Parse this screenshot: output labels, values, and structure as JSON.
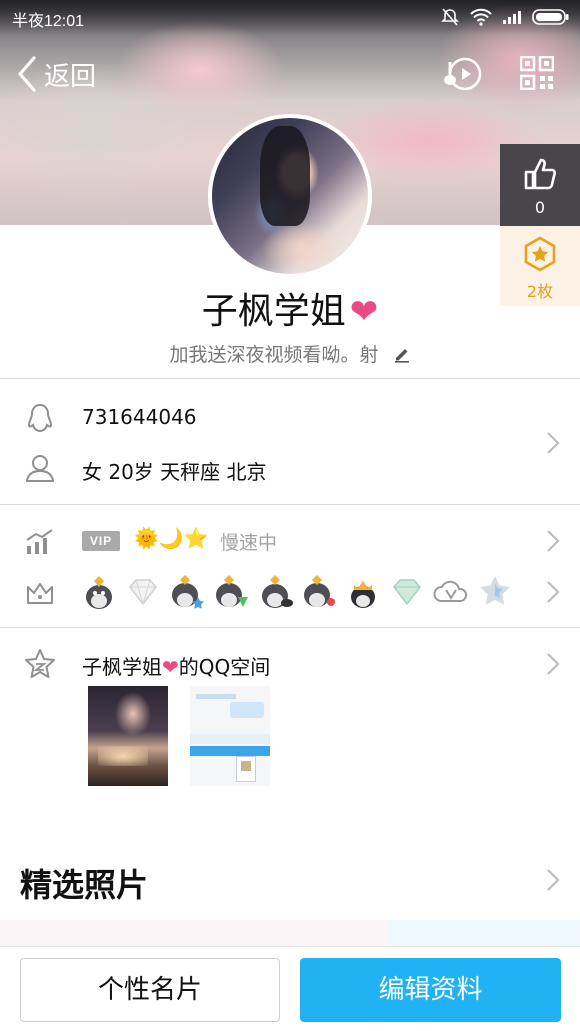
{
  "status_bar": {
    "time": "半夜12:01"
  },
  "nav": {
    "back_label": "返回"
  },
  "profile": {
    "name": "子枫学姐",
    "signature": "加我送深夜视频看呦。射",
    "likes": "0",
    "medals": "2枚"
  },
  "info": {
    "qq_number": "731644046",
    "details": "女  20岁  天秤座  北京"
  },
  "vip": {
    "tag": "VIP",
    "level_icons": "🌞🌙⭐",
    "speed_text": "慢速中"
  },
  "badges": [
    "penguin-gold-badge",
    "diamond-badge",
    "penguin-star-badge",
    "penguin-green-badge",
    "penguin-badge",
    "penguin-game-badge",
    "penguin-crown-badge",
    "gem-badge",
    "cloud-v-badge",
    "star-badge"
  ],
  "qzone": {
    "title_prefix": "子枫学姐",
    "title_suffix": "的QQ空间"
  },
  "featured": {
    "title": "精选照片"
  },
  "bottom": {
    "card_button": "个性名片",
    "edit_button": "编辑资料"
  },
  "colors": {
    "accent": "#21b2f3",
    "heart": "#e94a85",
    "medal": "#e9a11b"
  }
}
